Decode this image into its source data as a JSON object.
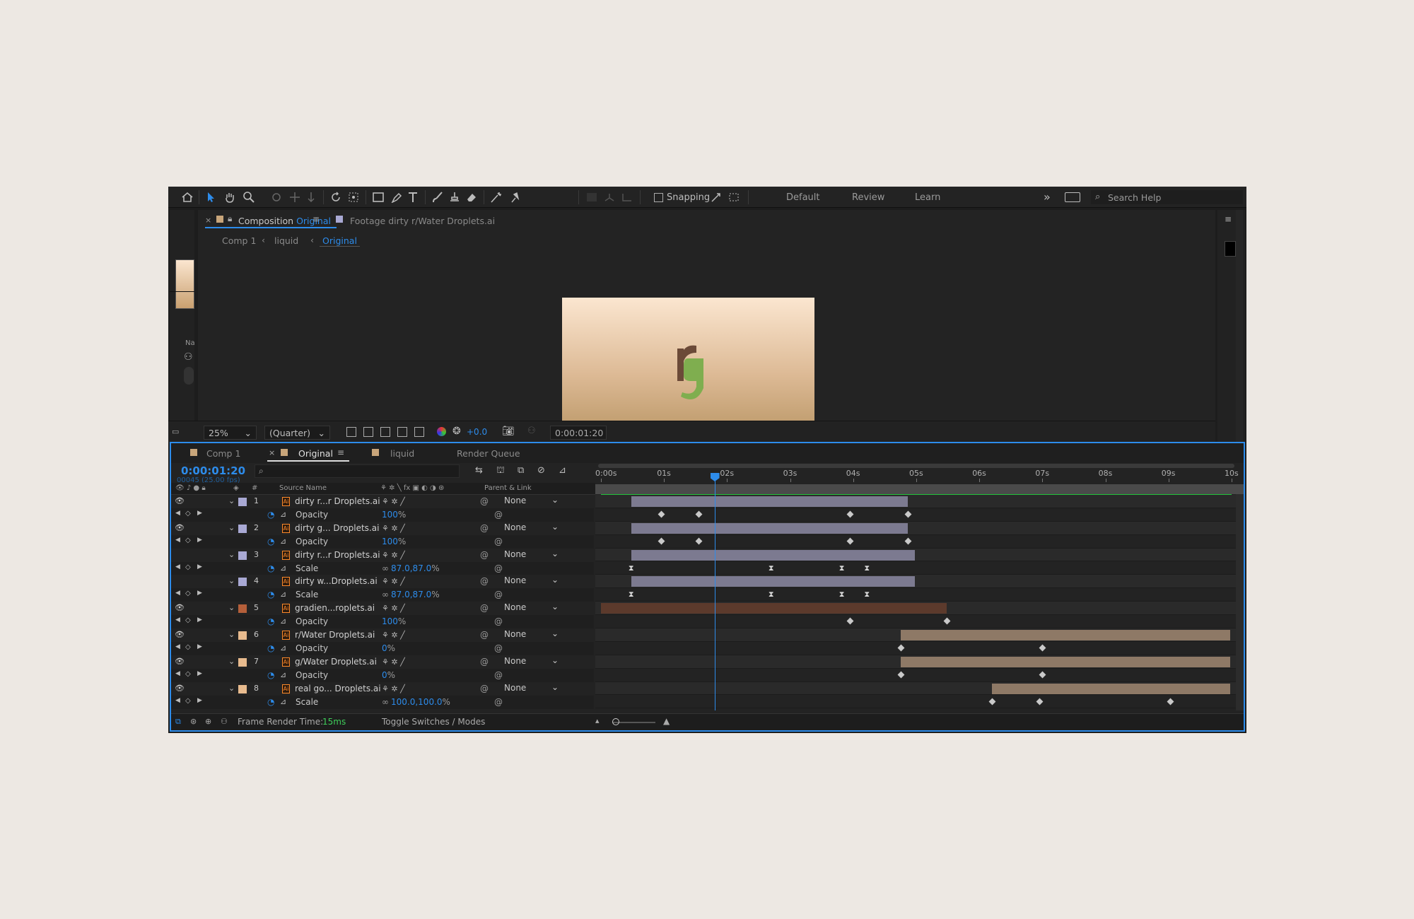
{
  "toolbar": {
    "snapping_label": "Snapping",
    "workspaces": [
      "Default",
      "Review",
      "Learn"
    ],
    "search_placeholder": "Search Help"
  },
  "composition_panel": {
    "tab_prefix": "Composition",
    "tab_name": "Original",
    "footage_tab_prefix": "Footage",
    "footage_tab_name": "dirty r/Water Droplets.ai",
    "breadcrumbs": [
      "Comp 1",
      "liquid",
      "Original"
    ],
    "project_na_label": "Na",
    "zoom": "25%",
    "resolution": "(Quarter)",
    "exposure": "+0.0",
    "timecode": "0:00:01:20"
  },
  "timeline": {
    "tabs": [
      {
        "label": "Comp 1",
        "color": "#c8a57a"
      },
      {
        "label": "Original",
        "color": "#c8a57a",
        "active": true
      },
      {
        "label": "liquid",
        "color": "#c8a57a"
      },
      {
        "label": "Render Queue"
      }
    ],
    "current_time": "0:00:01:20",
    "frame_info": "00045 (25.00 fps)",
    "columns": {
      "num": "#",
      "source_name": "Source Name",
      "parent": "Parent & Link"
    },
    "time_ticks": [
      "0:00s",
      "01s",
      "02s",
      "03s",
      "04s",
      "05s",
      "06s",
      "07s",
      "08s",
      "09s",
      "10s"
    ],
    "layers": [
      {
        "num": "1",
        "name": "dirty r...r Droplets.ai",
        "color": "#a9a9d4",
        "parent": "None",
        "prop": "Opacity",
        "value": "100",
        "unit": "%"
      },
      {
        "num": "2",
        "name": "dirty g... Droplets.ai",
        "color": "#a9a9d4",
        "parent": "None",
        "prop": "Opacity",
        "value": "100",
        "unit": "%"
      },
      {
        "num": "3",
        "name": "dirty r...r Droplets.ai",
        "color": "#a9a9d4",
        "parent": "None",
        "prop": "Scale",
        "value": "87.0,87.0",
        "unit": "%"
      },
      {
        "num": "4",
        "name": "dirty w...Droplets.ai",
        "color": "#a9a9d4",
        "parent": "None",
        "prop": "Scale",
        "value": "87.0,87.0",
        "unit": "%"
      },
      {
        "num": "5",
        "name": "gradien...roplets.ai",
        "color": "#b55f3a",
        "parent": "None",
        "prop": "Opacity",
        "value": "100",
        "unit": "%"
      },
      {
        "num": "6",
        "name": "r/Water Droplets.ai",
        "color": "#e8bb8e",
        "parent": "None",
        "prop": "Opacity",
        "value": "0",
        "unit": "%"
      },
      {
        "num": "7",
        "name": "g/Water Droplets.ai",
        "color": "#e8bb8e",
        "parent": "None",
        "prop": "Opacity",
        "value": "0",
        "unit": "%"
      },
      {
        "num": "8",
        "name": "real go... Droplets.ai",
        "color": "#e8bb8e",
        "parent": "None",
        "prop": "Scale",
        "value": "100.0,100.0",
        "unit": "%"
      }
    ],
    "status": {
      "frame_render_label": "Frame Render Time:",
      "frame_render_value": "15ms",
      "toggle_label": "Toggle Switches / Modes"
    }
  },
  "colors": {
    "accent": "#2d8ceb",
    "work_area": "#22c23a",
    "bar_purple": "#7c7a90",
    "bar_brown": "#5c3a2c",
    "bar_tan": "#8e7966"
  }
}
